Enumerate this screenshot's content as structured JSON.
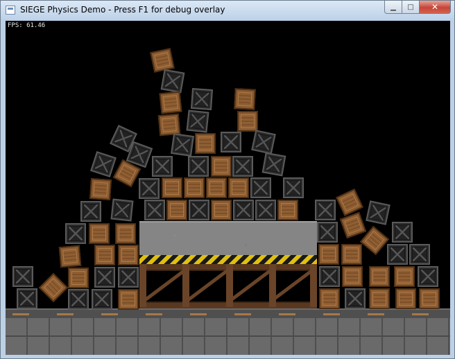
{
  "window": {
    "title": "SIEGE Physics Demo - Press F1 for debug overlay",
    "minimize_glyph": "▁",
    "maximize_glyph": "□",
    "close_glyph": "✕"
  },
  "hud": {
    "fps_text": "FPS: 61.46"
  },
  "colors": {
    "background": "#000000",
    "wood_crate": "#8a5a30",
    "metal_crate": "#2c2c2c",
    "hazard_yellow": "#e0c010",
    "girder": "#5a3820",
    "ground": "#5f5f5f"
  },
  "icons": [
    "app-icon",
    "minimize-icon",
    "maximize-icon",
    "close-icon"
  ]
}
